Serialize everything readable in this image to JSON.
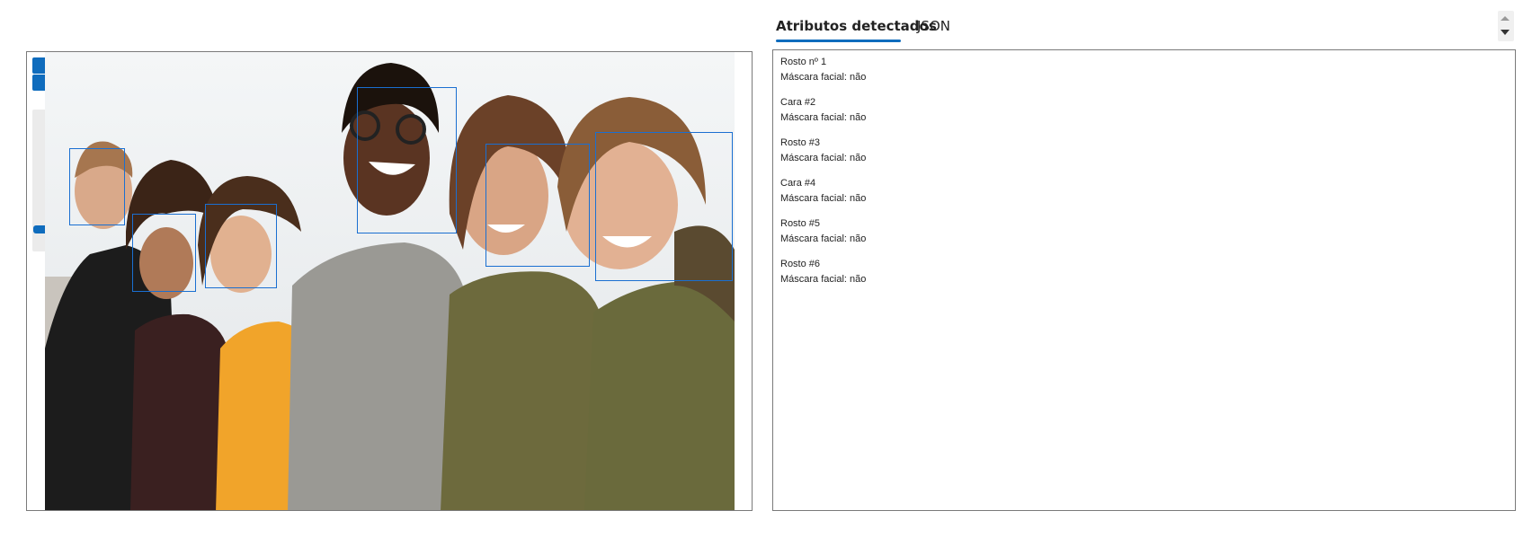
{
  "tabs": {
    "detected_attributes": "Atributos detectados",
    "json": "JSON",
    "active": "detected_attributes"
  },
  "viewer": {
    "zoom_level_fraction": 0.18,
    "image_alt": "Grupo de seis pessoas sorrindo",
    "detected_face_count": 6
  },
  "results": [
    {
      "title": "Rosto nº 1",
      "attribute": "Máscara facial: não"
    },
    {
      "title": "Cara #2",
      "attribute": "Máscara facial: não"
    },
    {
      "title": "Rosto #3",
      "attribute": "Máscara facial: não"
    },
    {
      "title": "Cara #4",
      "attribute": "Máscara facial: não"
    },
    {
      "title": "Rosto #5",
      "attribute": "Máscara facial: não"
    },
    {
      "title": "Rosto #6",
      "attribute": "Máscara facial: não"
    }
  ],
  "colors": {
    "accent": "#0f6cbd",
    "face_box": "#1a6fd1",
    "panel_border": "#7a7a7a"
  }
}
